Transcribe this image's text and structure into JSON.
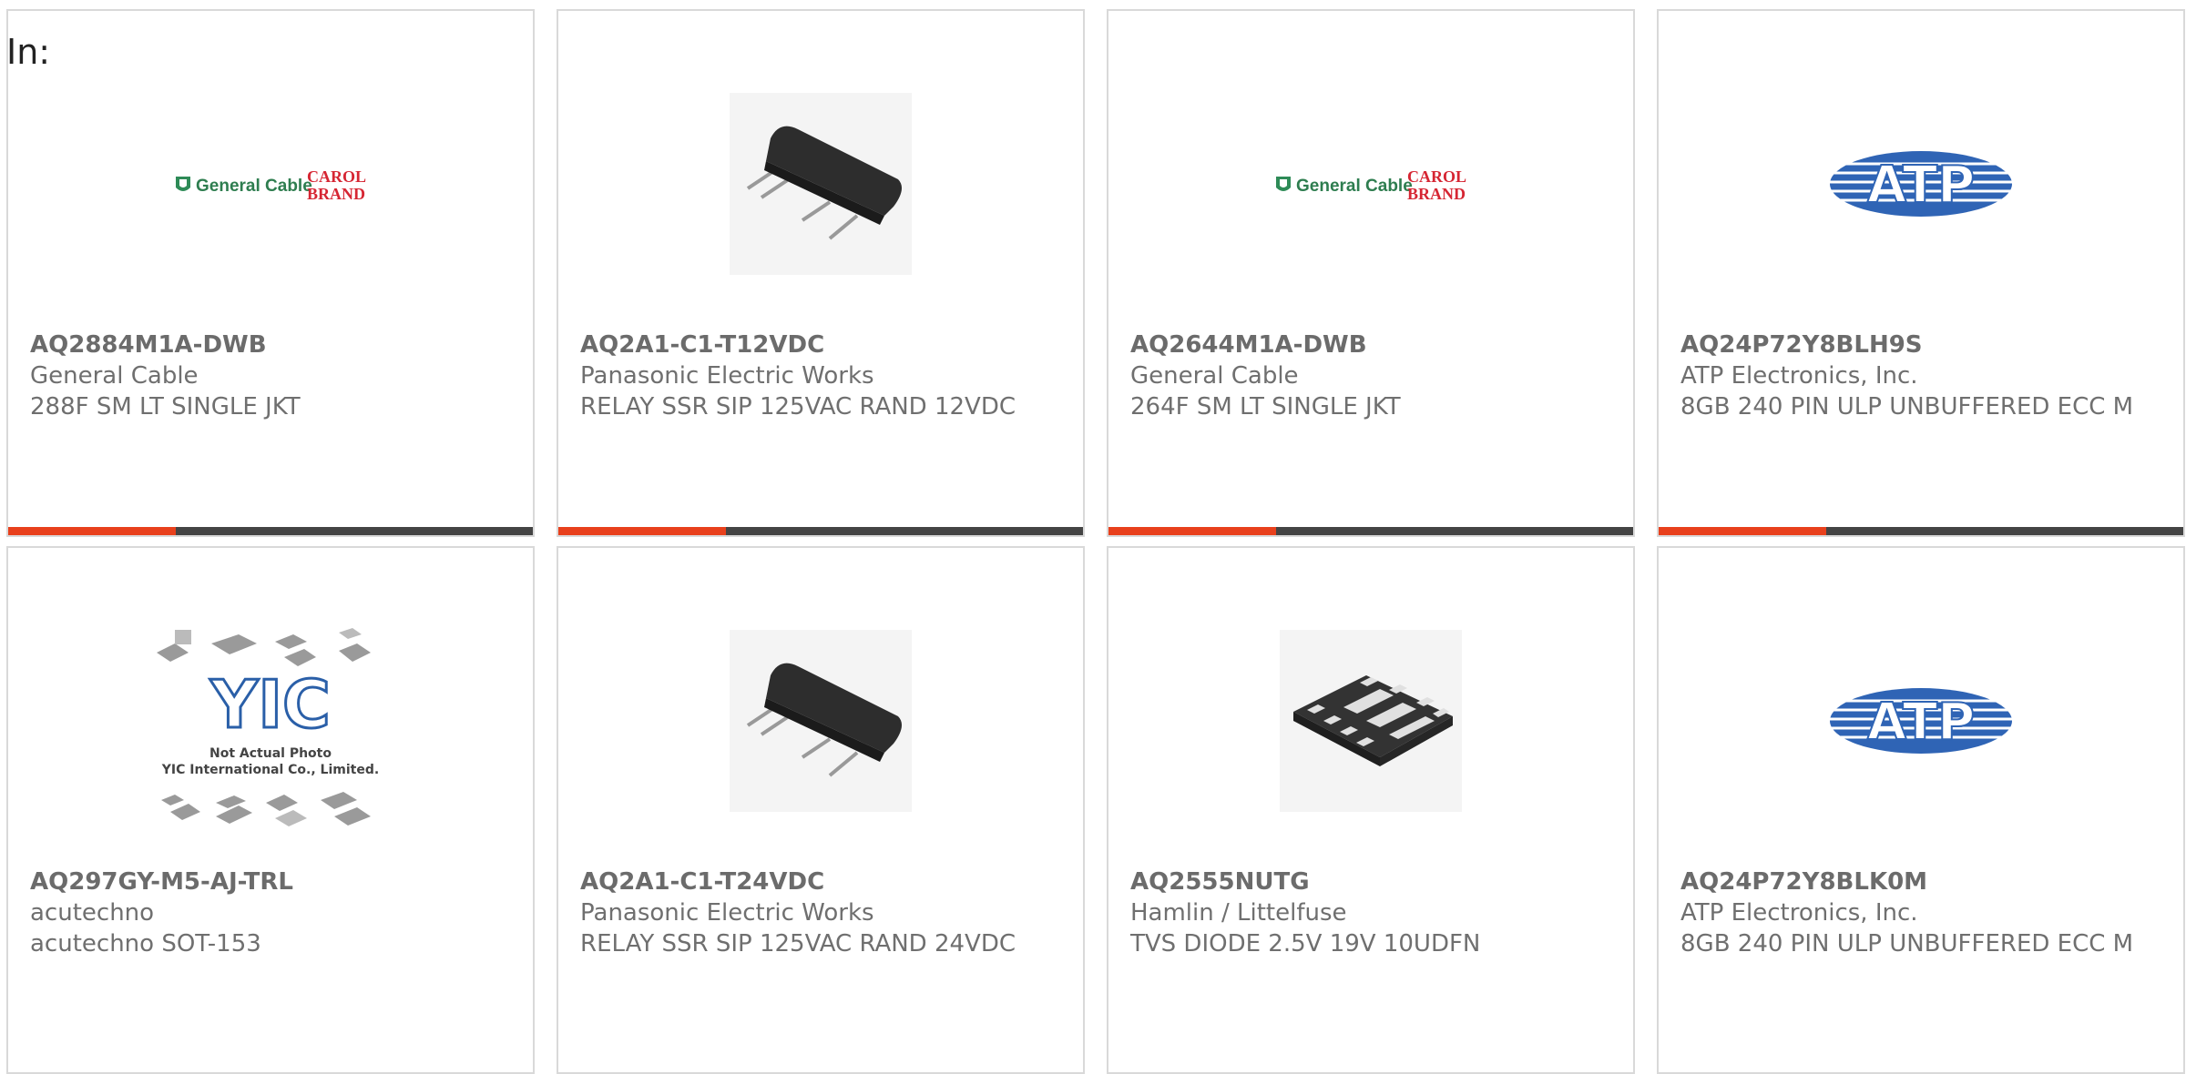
{
  "header": {
    "in_label": "In:"
  },
  "colors": {
    "accent": "#e8401c",
    "bar": "#444444",
    "border": "#d9d9d9",
    "text": "#6f6f6f"
  },
  "products": [
    {
      "part": "AQ2884M1A-DWB",
      "manufacturer": "General Cable",
      "description": "288F SM LT SINGLE JKT",
      "image": "general-cable-logo",
      "logo_text": {
        "left": "General Cable",
        "right_top": "CAROL",
        "right_bottom": "BRAND"
      }
    },
    {
      "part": "AQ2A1-C1-T12VDC",
      "manufacturer": "Panasonic Electric Works",
      "description": "RELAY SSR SIP 125VAC RAND 12VDC",
      "image": "sip-relay-photo"
    },
    {
      "part": "AQ2644M1A-DWB",
      "manufacturer": "General Cable",
      "description": "264F SM LT SINGLE JKT",
      "image": "general-cable-logo",
      "logo_text": {
        "left": "General Cable",
        "right_top": "CAROL",
        "right_bottom": "BRAND"
      }
    },
    {
      "part": "AQ24P72Y8BLH9S",
      "manufacturer": "ATP Electronics, Inc.",
      "description": "8GB 240 PIN ULP UNBUFFERED ECC M",
      "image": "atp-logo",
      "logo_text": {
        "main": "ATP"
      }
    },
    {
      "part": "AQ297GY-M5-AJ-TRL",
      "manufacturer": "acutechno",
      "description": "acutechno SOT-153",
      "image": "yic-placeholder",
      "logo_text": {
        "main": "YIC",
        "line1": "Not Actual Photo",
        "line2": "YIC International Co., Limited."
      }
    },
    {
      "part": "AQ2A1-C1-T24VDC",
      "manufacturer": "Panasonic Electric Works",
      "description": "RELAY SSR SIP 125VAC RAND 24VDC",
      "image": "sip-relay-photo"
    },
    {
      "part": "AQ2555NUTG",
      "manufacturer": "Hamlin / Littelfuse",
      "description": "TVS DIODE 2.5V 19V 10UDFN",
      "image": "udfn-chip-photo"
    },
    {
      "part": "AQ24P72Y8BLK0M",
      "manufacturer": "ATP Electronics, Inc.",
      "description": "8GB 240 PIN ULP UNBUFFERED ECC M",
      "image": "atp-logo",
      "logo_text": {
        "main": "ATP"
      }
    }
  ]
}
